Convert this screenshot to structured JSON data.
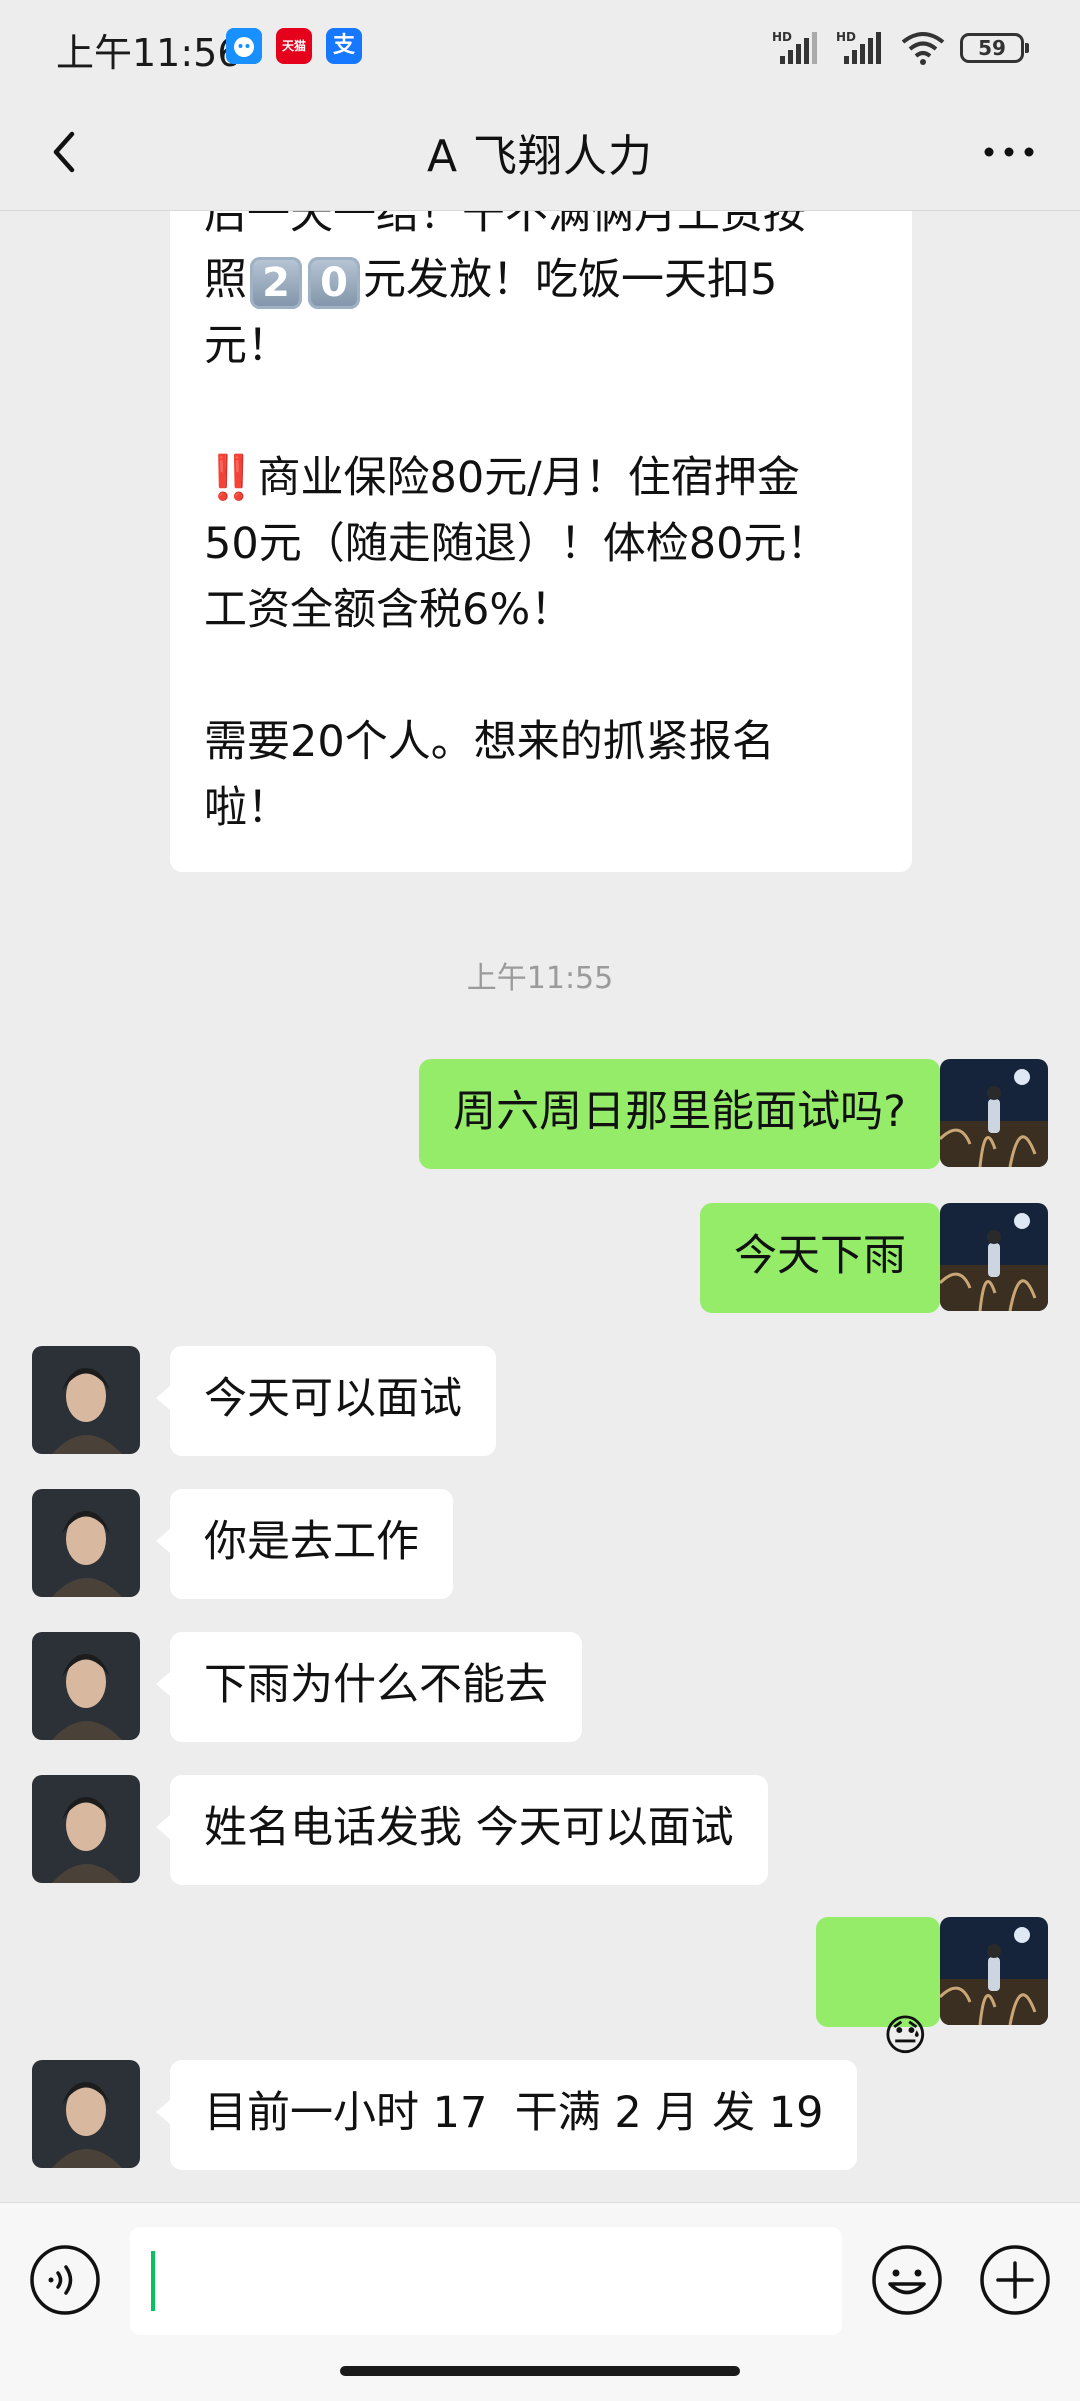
{
  "status_bar": {
    "time": "上午11:56",
    "app_icons": [
      "app-icon-blue",
      "tmall-icon",
      "alipay-icon"
    ],
    "tmall_label": "天猫",
    "alipay_label": "支",
    "signal1_label": "HD",
    "signal2_label": "HD",
    "battery": "59"
  },
  "header": {
    "title": "A 飞翔人力"
  },
  "messages": {
    "m0_line1": "后一天一结！干不满俩月工资按",
    "m0_line2_pre": "照",
    "m0_key1": "2",
    "m0_key2": "0",
    "m0_line2_post": "元发放！吃饭一天扣5",
    "m0_line3": "元！",
    "m0_bang": "‼️",
    "m0_line4": "商业保险80元/月！住宿押金",
    "m0_line5": "50元（随走随退）！体检80元！",
    "m0_line6": "工资全额含税6%！",
    "m0_line7": "需要20个人。想来的抓紧报名",
    "m0_line8": "啦！",
    "timestamp": "上午11:55",
    "m1": "周六周日那里能面试吗?",
    "m2": "今天下雨",
    "m3": "今天可以面试",
    "m4": "你是去工作",
    "m5": "下雨为什么不能去",
    "m6": "姓名电话发我 今天可以面试",
    "m7_emoji": "😓",
    "m8": "目前一小时 17  干满 2 月 发 19"
  },
  "input": {
    "value": ""
  },
  "colors": {
    "background": "#ededed",
    "sent_bubble": "#95ec69",
    "received_bubble": "#ffffff",
    "caret": "#07c160"
  }
}
